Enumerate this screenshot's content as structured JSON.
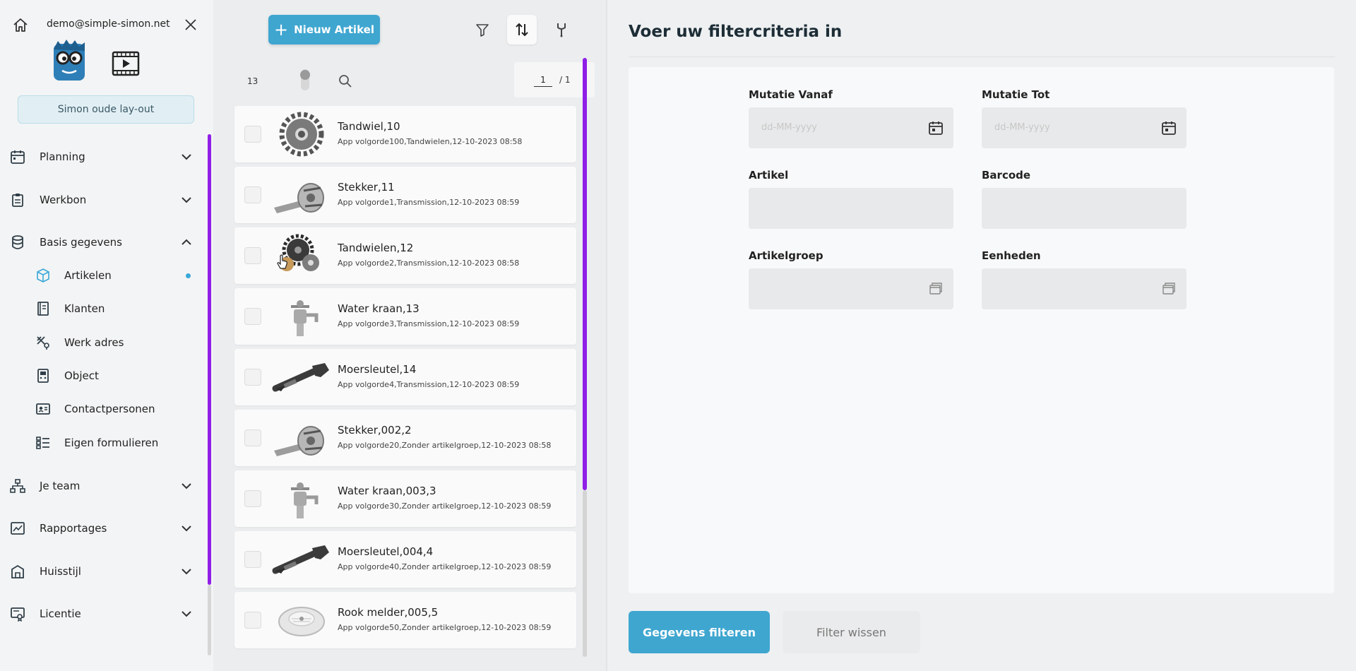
{
  "sidebar": {
    "email": "demo@simple-simon.net",
    "old_layout_label": "Simon oude lay-out",
    "items": [
      {
        "label": "Planning",
        "icon": "calendar-icon"
      },
      {
        "label": "Werkbon",
        "icon": "clipboard-icon"
      },
      {
        "label": "Basis gegevens",
        "icon": "database-icon"
      },
      {
        "label": "Je team",
        "icon": "team-icon"
      },
      {
        "label": "Rapportages",
        "icon": "report-icon"
      },
      {
        "label": "Huisstijl",
        "icon": "brand-icon"
      },
      {
        "label": "Licentie",
        "icon": "license-icon"
      }
    ],
    "sub_items": [
      {
        "label": "Artikelen",
        "icon": "cube-icon",
        "active": true
      },
      {
        "label": "Klanten",
        "icon": "book-icon"
      },
      {
        "label": "Werk adres",
        "icon": "tools-location-icon"
      },
      {
        "label": "Object",
        "icon": "object-icon"
      },
      {
        "label": "Contactpersonen",
        "icon": "contact-card-icon"
      },
      {
        "label": "Eigen formulieren",
        "icon": "form-list-icon"
      }
    ]
  },
  "list": {
    "new_button_label": "Nieuw Artikel",
    "count": "13",
    "page_current": "1",
    "page_total": "/ 1",
    "rows": [
      {
        "title": "Tandwiel,10",
        "subtitle": "App volgorde100,Tandwielen,12-10-2023 08:58",
        "thumb": "gear"
      },
      {
        "title": "Stekker,11",
        "subtitle": "App volgorde1,Transmission,12-10-2023 08:59",
        "thumb": "plug"
      },
      {
        "title": "Tandwielen,12",
        "subtitle": "App volgorde2,Transmission,12-10-2023 08:58",
        "thumb": "gears"
      },
      {
        "title": "Water kraan,13",
        "subtitle": "App volgorde3,Transmission,12-10-2023 08:59",
        "thumb": "tap"
      },
      {
        "title": "Moersleutel,14",
        "subtitle": "App volgorde4,Transmission,12-10-2023 08:59",
        "thumb": "wrench"
      },
      {
        "title": "Stekker,002,2",
        "subtitle": "App volgorde20,Zonder artikelgroep,12-10-2023 08:58",
        "thumb": "plug"
      },
      {
        "title": "Water kraan,003,3",
        "subtitle": "App volgorde30,Zonder artikelgroep,12-10-2023 08:59",
        "thumb": "tap"
      },
      {
        "title": "Moersleutel,004,4",
        "subtitle": "App volgorde40,Zonder artikelgroep,12-10-2023 08:59",
        "thumb": "wrench"
      },
      {
        "title": "Rook melder,005,5",
        "subtitle": "App volgorde50,Zonder artikelgroep,12-10-2023 08:59",
        "thumb": "smoke"
      }
    ]
  },
  "filter": {
    "title": "Voer uw filtercriteria in",
    "fields": {
      "mutatie_vanaf": {
        "label": "Mutatie Vanaf",
        "placeholder": "dd-MM-yyyy"
      },
      "mutatie_tot": {
        "label": "Mutatie Tot",
        "placeholder": "dd-MM-yyyy"
      },
      "artikel": {
        "label": "Artikel"
      },
      "barcode": {
        "label": "Barcode"
      },
      "artikelgroep": {
        "label": "Artikelgroep"
      },
      "eenheden": {
        "label": "Eenheden"
      }
    },
    "apply_label": "Gegevens filteren",
    "clear_label": "Filter wissen"
  },
  "colors": {
    "accent": "#3fa6d0",
    "scrollbar": "#8f1fe6",
    "active_dot": "#39a8d8"
  }
}
